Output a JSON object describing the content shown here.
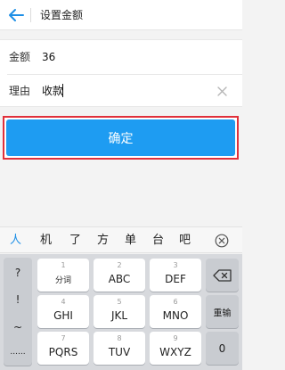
{
  "header": {
    "title": "设置金额"
  },
  "form": {
    "amount": {
      "label": "金额",
      "value": "36"
    },
    "reason": {
      "label": "理由",
      "value": "收款"
    }
  },
  "confirm_label": "确定",
  "candidates": [
    "人",
    "机",
    "了",
    "方",
    "单",
    "台",
    "吧"
  ],
  "keyboard": {
    "left_symbols": [
      "?",
      "!",
      "~",
      "......"
    ],
    "keys": [
      {
        "num": "1",
        "label": "分词"
      },
      {
        "num": "2",
        "label": "ABC"
      },
      {
        "num": "3",
        "label": "DEF"
      },
      {
        "num": "4",
        "label": "GHI"
      },
      {
        "num": "5",
        "label": "JKL"
      },
      {
        "num": "6",
        "label": "MNO"
      },
      {
        "num": "7",
        "label": "PQRS"
      },
      {
        "num": "8",
        "label": "TUV"
      },
      {
        "num": "9",
        "label": "WXYZ"
      }
    ],
    "reenter_label": "重输",
    "zero_label": "0"
  },
  "colors": {
    "accent": "#1e9cf2",
    "highlight_border": "#e0303b"
  }
}
